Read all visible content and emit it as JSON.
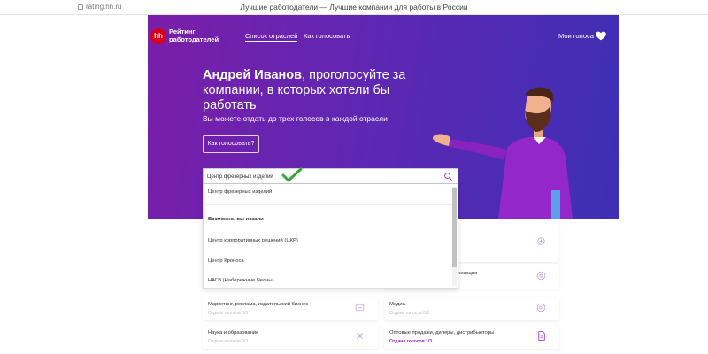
{
  "browser": {
    "url": "rating.hh.ru",
    "title": "Лучшие работодатели — Лучшие компании для работы в России"
  },
  "header": {
    "logo_mark": "hh",
    "logo_text_1": "Рейтинг",
    "logo_text_2": "работодателей",
    "nav": [
      {
        "label": "Список отраслей",
        "active": true
      },
      {
        "label": "Как голосовать",
        "active": false
      }
    ],
    "my_votes": "Мои голоса"
  },
  "hero": {
    "user_name": "Андрей Иванов",
    "headline_rest": ", проголосуйте за компании, в которых хотели бы работать",
    "subline": "Вы можете отдать до трех голосов в каждой отрасли",
    "how_button": "Как голосовать?"
  },
  "search": {
    "value": "Центр фрезерных изделий"
  },
  "dropdown": {
    "exact": "Центр фрезерных изделий",
    "maybe_heading": "Возможно, вы искали",
    "suggestions": [
      "Центр корпоративных решений (ЦКР)",
      "Центр Кроноса",
      "НАГВ (Набережные Челны)"
    ]
  },
  "cards": [
    {
      "name": "",
      "votes": ""
    },
    {
      "name": "",
      "votes": ""
    },
    {
      "name": "Маркетинг, реклама, издательский бизнес",
      "votes": "Отдано голосов 0/3"
    },
    {
      "name": "Медиа",
      "votes": "Отдано голосов 0/3"
    },
    {
      "name": "Наука и образование",
      "votes": "Отдано голосов 0/3"
    },
    {
      "name": "Оптовые продажи, дилеры, дистрибьюторы",
      "votes": "Отдано голосов 1/3"
    }
  ],
  "partial_card_text": "ганизация",
  "colors": {
    "accent": "#9d25c9",
    "hero_start": "#7a1ea8",
    "hero_end": "#3d2fb4",
    "check": "#3aa63a",
    "logo_red": "#d6001c"
  }
}
